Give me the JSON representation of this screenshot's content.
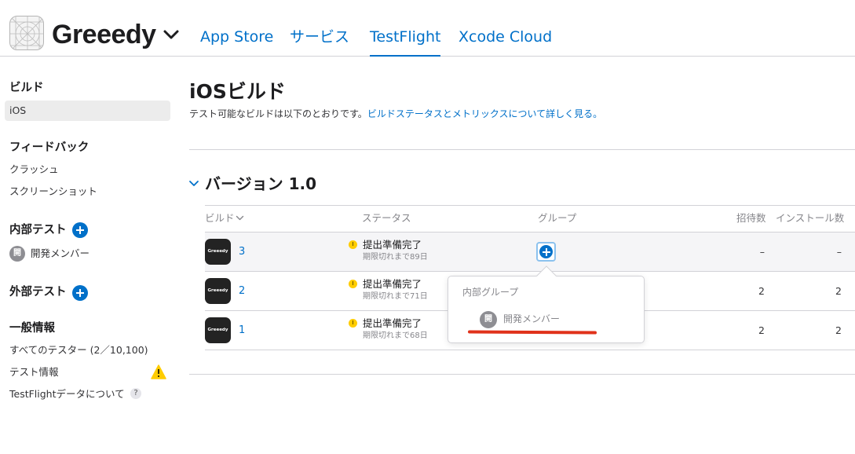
{
  "header": {
    "app_name": "Greeedy",
    "tabs": [
      {
        "label": "App Store"
      },
      {
        "label": "サービス"
      },
      {
        "label": "TestFlight"
      },
      {
        "label": "Xcode Cloud"
      }
    ],
    "active_tab": "TestFlight"
  },
  "sidebar": {
    "builds_heading": "ビルド",
    "builds_items": [
      {
        "label": "iOS",
        "selected": true
      }
    ],
    "feedback_heading": "フィードバック",
    "feedback_items": [
      {
        "label": "クラッシュ"
      },
      {
        "label": "スクリーンショット"
      }
    ],
    "internal_heading": "内部テスト",
    "internal_items": [
      {
        "label": "開発メンバー",
        "badge": "開"
      }
    ],
    "external_heading": "外部テスト",
    "general_heading": "一般情報",
    "general_items": [
      {
        "label": "すべてのテスター (2／10,100)"
      },
      {
        "label": "テスト情報",
        "icon": "warning-icon"
      },
      {
        "label": "TestFlightデータについて",
        "icon": "help-icon",
        "icon_text": "?"
      }
    ]
  },
  "main": {
    "title": "iOSビルド",
    "subtitle": "テスト可能なビルドは以下のとおりです。",
    "subtitle_link": "ビルドステータスとメトリックスについて詳しく見る。",
    "version_title": "バージョン 1.0",
    "columns": {
      "build": "ビルド",
      "status": "ステータス",
      "group": "グループ",
      "invites": "招待数",
      "installs": "インストール数"
    },
    "rows": [
      {
        "thumb": "Greeedy",
        "build": "3",
        "status": "提出準備完了",
        "expiry": "期限切れまで89日",
        "invites": "–",
        "installs": "–"
      },
      {
        "thumb": "Greeedy",
        "build": "2",
        "status": "提出準備完了",
        "expiry": "期限切れまで71日",
        "invites": "2",
        "installs": "2"
      },
      {
        "thumb": "Greeedy",
        "build": "1",
        "status": "提出準備完了",
        "expiry": "期限切れまで68日",
        "invites": "2",
        "installs": "2"
      }
    ]
  },
  "popover": {
    "heading": "内部グループ",
    "items": [
      {
        "label": "開発メンバー",
        "badge": "開"
      }
    ]
  },
  "colors": {
    "accent": "#0070c9",
    "status_warning": "#ffcc00",
    "annotation_red": "#e0321b"
  }
}
